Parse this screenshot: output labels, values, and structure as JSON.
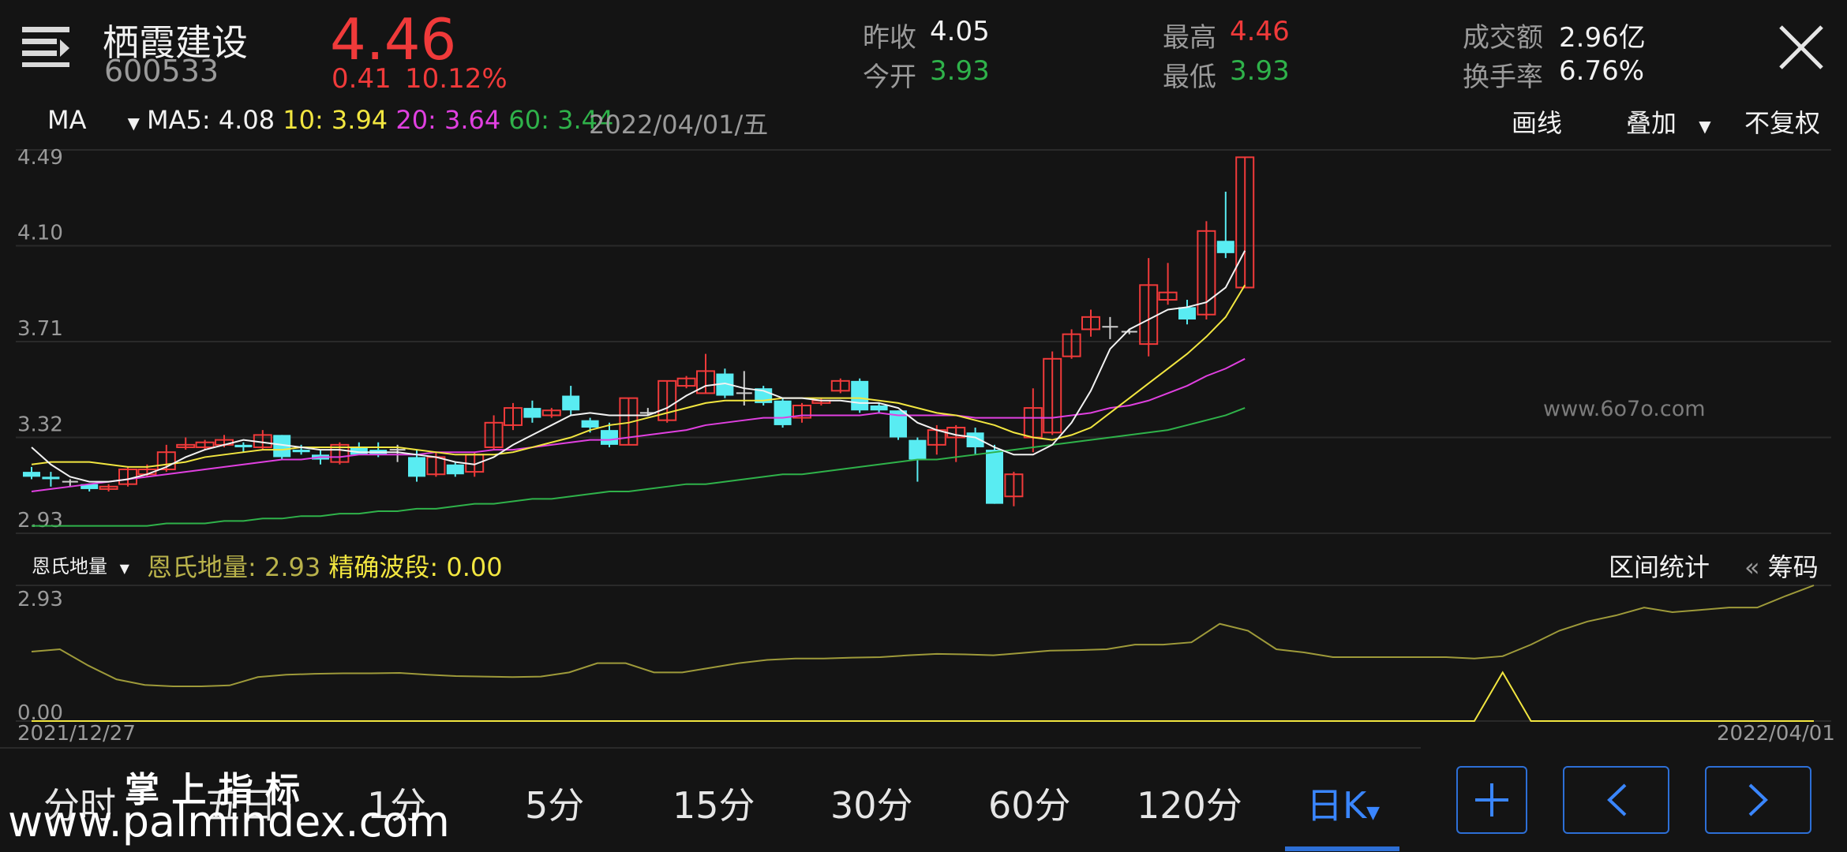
{
  "header": {
    "stock_name": "栖霞建设",
    "stock_code": "600533",
    "price": "4.46",
    "change": "0.41",
    "change_pct": "10.12%",
    "prev_close_label": "昨收",
    "prev_close": "4.05",
    "open_label": "今开",
    "open": "3.93",
    "high_label": "最高",
    "high": "4.46",
    "low_label": "最低",
    "low": "3.93",
    "amount_label": "成交额",
    "amount": "2.96亿",
    "turnover_label": "换手率",
    "turnover": "6.76%"
  },
  "ma_bar": {
    "indicator": "MA",
    "ma5": "MA5: 4.08",
    "ma10": "10: 3.94",
    "ma20": "20: 3.64",
    "ma60": "60: 3.44",
    "date": "2022/04/01/五",
    "draw_line": "画线",
    "overlay": "叠加",
    "adjust": "不复权"
  },
  "sub_bar": {
    "indicator": "恩氏地量",
    "value1": "恩氏地量: 2.93",
    "value2": "精确波段: 0.00",
    "range_stats": "区间统计",
    "chips": "筹码"
  },
  "dates": {
    "start": "2021/12/27",
    "end": "2022/04/01"
  },
  "periods": [
    "分时",
    "五日",
    "1分",
    "5分",
    "15分",
    "30分",
    "60分",
    "120分",
    "日K"
  ],
  "watermarks": {
    "top": "www.6o7o.com",
    "bottom_title": "掌 上 指 标",
    "bottom_url": "www.palmindex.com"
  },
  "colors": {
    "up": "#f03a3a",
    "down": "#59ecf2",
    "ma5": "#f2f2f2",
    "ma10": "#f2e640",
    "ma20": "#e040e0",
    "ma60": "#2fb24a",
    "accent": "#2d6fd6"
  },
  "chart_data": [
    {
      "type": "candlestick",
      "title": "",
      "y_ticks": [
        "4.49",
        "4.10",
        "3.71",
        "3.32",
        "2.93"
      ],
      "ylim": [
        2.93,
        4.49
      ],
      "candles": [
        [
          3.18,
          3.16,
          3.2,
          3.15
        ],
        [
          3.16,
          3.15,
          3.18,
          3.12
        ],
        [
          3.14,
          3.14,
          3.15,
          3.12
        ],
        [
          3.13,
          3.11,
          3.13,
          3.1
        ],
        [
          3.11,
          3.12,
          3.13,
          3.1
        ],
        [
          3.13,
          3.19,
          3.2,
          3.12
        ],
        [
          3.17,
          3.19,
          3.21,
          3.16
        ],
        [
          3.19,
          3.26,
          3.29,
          3.18
        ],
        [
          3.28,
          3.29,
          3.32,
          3.27
        ],
        [
          3.28,
          3.3,
          3.31,
          3.27
        ],
        [
          3.29,
          3.31,
          3.33,
          3.28
        ],
        [
          3.29,
          3.28,
          3.3,
          3.26
        ],
        [
          3.28,
          3.33,
          3.35,
          3.27
        ],
        [
          3.33,
          3.24,
          3.33,
          3.23
        ],
        [
          3.27,
          3.26,
          3.29,
          3.25
        ],
        [
          3.25,
          3.23,
          3.27,
          3.21
        ],
        [
          3.22,
          3.29,
          3.3,
          3.21
        ],
        [
          3.28,
          3.25,
          3.3,
          3.25
        ],
        [
          3.27,
          3.25,
          3.3,
          3.24
        ],
        [
          3.27,
          3.27,
          3.29,
          3.22
        ],
        [
          3.24,
          3.16,
          3.27,
          3.14
        ],
        [
          3.17,
          3.24,
          3.26,
          3.16
        ],
        [
          3.21,
          3.17,
          3.22,
          3.16
        ],
        [
          3.18,
          3.25,
          3.26,
          3.16
        ],
        [
          3.28,
          3.38,
          3.41,
          3.27
        ],
        [
          3.37,
          3.44,
          3.46,
          3.35
        ],
        [
          3.44,
          3.4,
          3.47,
          3.38
        ],
        [
          3.41,
          3.43,
          3.44,
          3.4
        ],
        [
          3.49,
          3.43,
          3.53,
          3.41
        ],
        [
          3.39,
          3.36,
          3.4,
          3.34
        ],
        [
          3.35,
          3.29,
          3.38,
          3.28
        ],
        [
          3.29,
          3.48,
          3.48,
          3.29
        ],
        [
          3.42,
          3.42,
          3.44,
          3.41
        ],
        [
          3.39,
          3.55,
          3.55,
          3.38
        ],
        [
          3.53,
          3.56,
          3.57,
          3.52
        ],
        [
          3.5,
          3.59,
          3.66,
          3.5
        ],
        [
          3.58,
          3.49,
          3.6,
          3.48
        ],
        [
          3.5,
          3.5,
          3.59,
          3.45
        ],
        [
          3.52,
          3.46,
          3.53,
          3.45
        ],
        [
          3.47,
          3.37,
          3.48,
          3.36
        ],
        [
          3.4,
          3.45,
          3.46,
          3.38
        ],
        [
          3.46,
          3.47,
          3.48,
          3.45
        ],
        [
          3.51,
          3.55,
          3.56,
          3.5
        ],
        [
          3.55,
          3.43,
          3.56,
          3.42
        ],
        [
          3.45,
          3.43,
          3.46,
          3.42
        ],
        [
          3.43,
          3.32,
          3.43,
          3.31
        ],
        [
          3.31,
          3.23,
          3.32,
          3.14
        ],
        [
          3.29,
          3.35,
          3.37,
          3.25
        ],
        [
          3.32,
          3.36,
          3.37,
          3.22
        ],
        [
          3.34,
          3.28,
          3.36,
          3.25
        ],
        [
          3.27,
          3.05,
          3.29,
          3.05
        ],
        [
          3.08,
          3.17,
          3.18,
          3.04
        ],
        [
          3.32,
          3.44,
          3.52,
          3.26
        ],
        [
          3.34,
          3.64,
          3.67,
          3.33
        ],
        [
          3.65,
          3.74,
          3.76,
          3.64
        ],
        [
          3.76,
          3.81,
          3.84,
          3.73
        ],
        [
          3.77,
          3.77,
          3.81,
          3.72
        ],
        [
          3.75,
          3.75,
          3.76,
          3.74
        ],
        [
          3.7,
          3.94,
          4.05,
          3.65
        ],
        [
          3.88,
          3.91,
          4.03,
          3.86
        ],
        [
          3.85,
          3.8,
          3.88,
          3.78
        ],
        [
          3.82,
          4.16,
          4.2,
          3.8
        ],
        [
          4.12,
          4.07,
          4.32,
          4.05
        ],
        [
          3.93,
          4.46,
          4.46,
          3.93
        ]
      ],
      "ma5": [
        3.28,
        3.21,
        3.16,
        3.14,
        3.14,
        3.15,
        3.17,
        3.2,
        3.24,
        3.27,
        3.29,
        3.31,
        3.3,
        3.29,
        3.28,
        3.27,
        3.27,
        3.26,
        3.26,
        3.26,
        3.25,
        3.24,
        3.22,
        3.21,
        3.24,
        3.29,
        3.33,
        3.37,
        3.41,
        3.42,
        3.41,
        3.41,
        3.41,
        3.44,
        3.49,
        3.53,
        3.54,
        3.52,
        3.51,
        3.48,
        3.48,
        3.47,
        3.47,
        3.46,
        3.46,
        3.44,
        3.38,
        3.35,
        3.33,
        3.32,
        3.28,
        3.25,
        3.25,
        3.29,
        3.38,
        3.51,
        3.68,
        3.76,
        3.8,
        3.84,
        3.85,
        3.87,
        3.93,
        4.08
      ],
      "ma10": [
        3.21,
        3.22,
        3.22,
        3.22,
        3.21,
        3.2,
        3.2,
        3.21,
        3.22,
        3.24,
        3.25,
        3.26,
        3.27,
        3.27,
        3.28,
        3.28,
        3.28,
        3.28,
        3.28,
        3.28,
        3.27,
        3.26,
        3.25,
        3.25,
        3.25,
        3.26,
        3.28,
        3.3,
        3.32,
        3.35,
        3.37,
        3.38,
        3.4,
        3.42,
        3.44,
        3.46,
        3.47,
        3.47,
        3.47,
        3.48,
        3.48,
        3.48,
        3.48,
        3.48,
        3.47,
        3.46,
        3.44,
        3.42,
        3.41,
        3.39,
        3.37,
        3.34,
        3.32,
        3.31,
        3.33,
        3.36,
        3.42,
        3.48,
        3.54,
        3.6,
        3.66,
        3.73,
        3.81,
        3.94
      ],
      "ma20": [
        3.1,
        3.11,
        3.12,
        3.13,
        3.14,
        3.15,
        3.16,
        3.17,
        3.18,
        3.19,
        3.2,
        3.21,
        3.22,
        3.23,
        3.23,
        3.24,
        3.24,
        3.25,
        3.25,
        3.25,
        3.25,
        3.26,
        3.26,
        3.26,
        3.27,
        3.27,
        3.28,
        3.29,
        3.3,
        3.31,
        3.31,
        3.32,
        3.33,
        3.34,
        3.35,
        3.37,
        3.38,
        3.39,
        3.4,
        3.4,
        3.41,
        3.41,
        3.41,
        3.41,
        3.42,
        3.41,
        3.41,
        3.41,
        3.41,
        3.4,
        3.4,
        3.4,
        3.4,
        3.4,
        3.41,
        3.42,
        3.44,
        3.45,
        3.47,
        3.5,
        3.53,
        3.57,
        3.6,
        3.64
      ],
      "ma60": [
        2.96,
        2.96,
        2.96,
        2.96,
        2.96,
        2.96,
        2.96,
        2.97,
        2.97,
        2.97,
        2.98,
        2.98,
        2.99,
        2.99,
        3.0,
        3.0,
        3.01,
        3.01,
        3.02,
        3.02,
        3.03,
        3.03,
        3.04,
        3.05,
        3.05,
        3.06,
        3.07,
        3.07,
        3.08,
        3.09,
        3.1,
        3.1,
        3.11,
        3.12,
        3.13,
        3.13,
        3.14,
        3.15,
        3.16,
        3.17,
        3.17,
        3.18,
        3.19,
        3.2,
        3.21,
        3.22,
        3.23,
        3.23,
        3.24,
        3.25,
        3.26,
        3.27,
        3.28,
        3.29,
        3.3,
        3.31,
        3.32,
        3.33,
        3.34,
        3.35,
        3.37,
        3.39,
        3.41,
        3.44
      ]
    },
    {
      "type": "line",
      "title": "",
      "y_ticks": [
        "2.93",
        "0.00"
      ],
      "ylim": [
        0.0,
        2.93
      ],
      "series": [
        {
          "name": "恩氏地量",
          "color": "#9e9a3a",
          "values": [
            1.5,
            1.55,
            1.2,
            0.9,
            0.78,
            0.75,
            0.75,
            0.77,
            0.95,
            1.0,
            1.02,
            1.03,
            1.03,
            1.04,
            1.0,
            0.97,
            0.96,
            0.95,
            0.96,
            1.05,
            1.25,
            1.25,
            1.05,
            1.05,
            1.15,
            1.25,
            1.32,
            1.35,
            1.35,
            1.37,
            1.38,
            1.42,
            1.45,
            1.44,
            1.42,
            1.47,
            1.52,
            1.53,
            1.55,
            1.65,
            1.65,
            1.7,
            2.1,
            1.95,
            1.55,
            1.48,
            1.38,
            1.38,
            1.38,
            1.38,
            1.38,
            1.35,
            1.4,
            1.65,
            1.95,
            2.15,
            2.28,
            2.45,
            2.35,
            2.4,
            2.45,
            2.45,
            2.7,
            2.93
          ]
        },
        {
          "name": "精确波段",
          "color": "#f2e640",
          "values": [
            0,
            0,
            0,
            0,
            0,
            0,
            0,
            0,
            0,
            0,
            0,
            0,
            0,
            0,
            0,
            0,
            0,
            0,
            0,
            0,
            0,
            0,
            0,
            0,
            0,
            0,
            0,
            0,
            0,
            0,
            0,
            0,
            0,
            0,
            0,
            0,
            0,
            0,
            0,
            0,
            0,
            0,
            0,
            0,
            0,
            0,
            0,
            0,
            0,
            0,
            0,
            0,
            1.05,
            0,
            0,
            0,
            0,
            0,
            0,
            0,
            0,
            0,
            0,
            0
          ]
        }
      ]
    }
  ]
}
